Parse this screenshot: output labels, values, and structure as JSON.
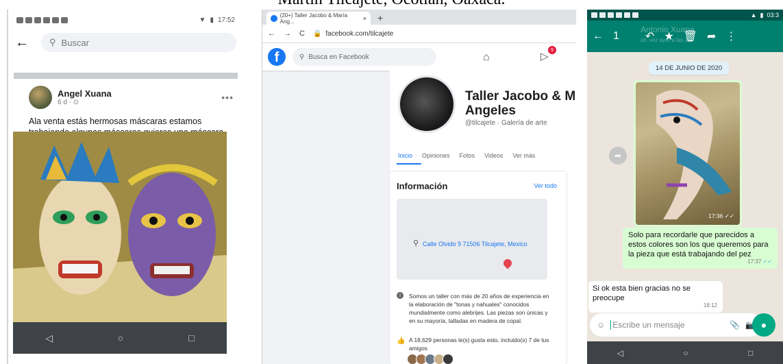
{
  "caption": "Martín Tilcajete, Ocotlán, Oaxaca.",
  "panel1": {
    "time": "17:52",
    "search_placeholder": "Buscar",
    "post": {
      "author": "Angel Xuana",
      "meta": "6 d · ⊙",
      "more": "•••",
      "text": "Ala venta estás hermosas máscaras  estamos trabajando  algunas máscaras quieres una máscara en especial has tu pedidos"
    }
  },
  "panel2": {
    "tab_title": "(20+) Taller Jacobo & María Ang...",
    "url": "facebook.com/tilcajete",
    "search_placeholder": "Busca en Facebook",
    "notif_count": "9",
    "page_name": "Taller Jacobo & M\nAngeles",
    "page_category": "@tilcajete · Galería de arte",
    "tabs": [
      "Inicio",
      "Opiniones",
      "Fotos",
      "Videos",
      "Ver más"
    ],
    "info_title": "Información",
    "see_all": "Ver todo",
    "address": "Calle Olvido 9 71506 Tilcajete, Mexico",
    "description": "Somos un taller con más de 20 años de experiencia en la elaboración de \"tonas y nahuales\" conocidos mundialmente como alebrijes. Las piezas son únicas y en su mayoría, talladas en madera de copal.",
    "likes": "A 18,629 personas le(s) gusta esto, incluido(s) 7 de tus amigos"
  },
  "panel3": {
    "time": "03:3",
    "selected_count": "1",
    "contact_ghost": "Antonio Xuana",
    "contact_status_ghost": "últ. vez ayer a las 2:..",
    "date_pill": "14 DE JUNIO DE 2020",
    "image_time": "17:36 ✓✓",
    "out_message": "Solo para recordarle que parecidos a estos colores son los que queremos para la pieza que está trabajando del pez",
    "out_time": "17:37",
    "out_ticks": "✓✓",
    "in_message": "Si ok esta bien gracias no se preocupe",
    "in_time": "18:12",
    "composer_placeholder": "Escribe un mensaje"
  }
}
